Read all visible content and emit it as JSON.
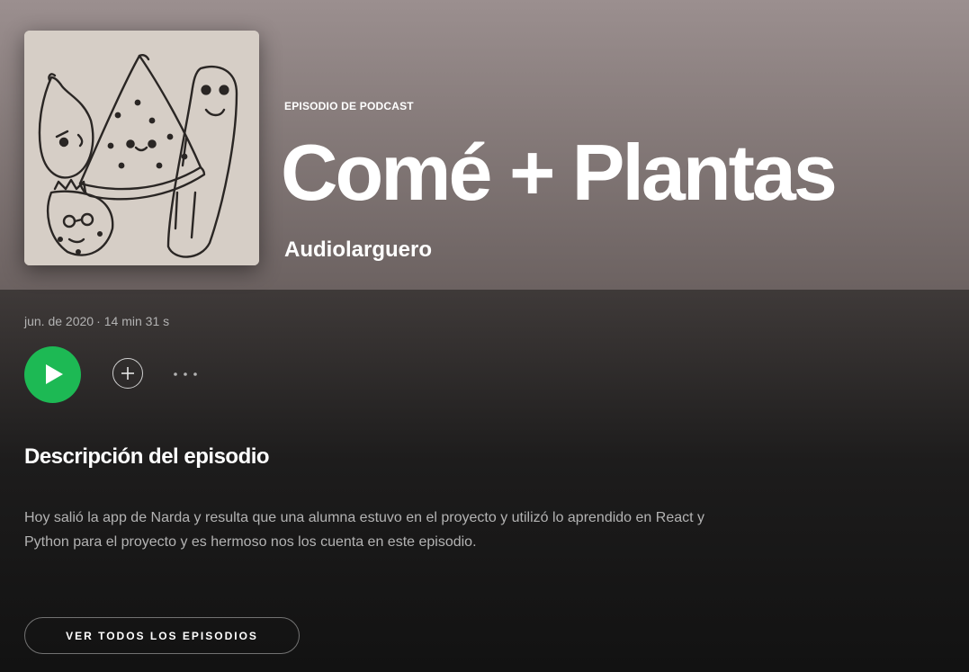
{
  "header": {
    "episode_type": "EPISODIO DE PODCAST",
    "title": "Comé + Plantas",
    "show_name": "Audiolarguero"
  },
  "meta": {
    "date": "jun. de 2020",
    "separator": "·",
    "duration": "14 min 31 s"
  },
  "actions": {
    "play_icon": "play-icon",
    "add_icon": "plus-circle-icon",
    "more_icon": "ellipsis-icon"
  },
  "description": {
    "heading": "Descripción del episodio",
    "text": "Hoy salió la app de Narda y resulta que una alumna estuvo en el proyecto y utilizó lo aprendido en React y Python para el proyecto y es hermoso nos los cuenta en este episodio."
  },
  "footer": {
    "all_episodes_label": "VER TODOS LOS EPISODIOS"
  },
  "colors": {
    "accent_green": "#1db954",
    "background": "#121212",
    "header_tint": "#857a79",
    "muted_text": "#b3b3b3"
  }
}
